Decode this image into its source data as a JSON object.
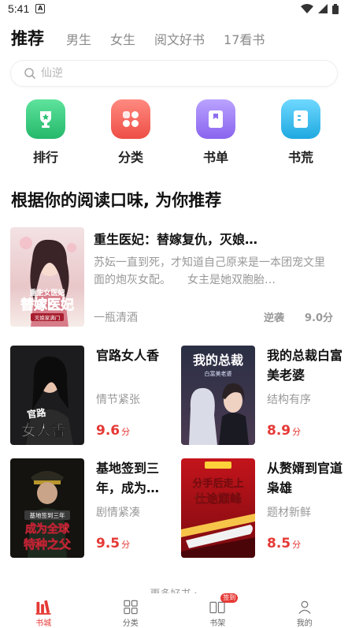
{
  "status_bar": {
    "time": "5:41",
    "notification_glyph": "A"
  },
  "tabs": [
    {
      "label": "推荐",
      "active": true
    },
    {
      "label": "男生",
      "active": false
    },
    {
      "label": "女生",
      "active": false
    },
    {
      "label": "阅文好书",
      "active": false
    },
    {
      "label": "17看书",
      "active": false
    }
  ],
  "search": {
    "placeholder": "仙逆"
  },
  "quick_links": [
    {
      "label": "排行",
      "icon": "trophy-icon",
      "color": "#34c77b"
    },
    {
      "label": "分类",
      "icon": "category-grid-icon",
      "color": "#f0645c"
    },
    {
      "label": "书单",
      "icon": "booklist-icon",
      "color": "#9b7cf2"
    },
    {
      "label": "书荒",
      "icon": "book-open-icon",
      "color": "#2fb7e8"
    }
  ],
  "section_title": "根据你的阅读口味, 为你推荐",
  "featured_book": {
    "title": "重生医妃：替嫁复仇，灭娘…",
    "description": "苏妘一直到死，才知道自己原来是一本团宠文里面的炮灰女配。　　女主是她双胞胎…",
    "author": "一瓶清酒",
    "tag": "逆袭",
    "score": "9.0分",
    "cover_text": "替嫁医妃",
    "cover_subtitle": "灭娘家满门",
    "cover_top": "重生女医妃"
  },
  "books": [
    {
      "title": "官路女人香",
      "tag": "情节紧张",
      "score": "9.6",
      "unit": "分",
      "cover_text_1": "官路",
      "cover_text_2": "女人香"
    },
    {
      "title": "我的总裁白富美老婆",
      "tag": "结构有序",
      "score": "8.9",
      "unit": "分",
      "cover_text_1": "我的总裁",
      "cover_text_2": "白富美老婆"
    },
    {
      "title": "基地签到三年，成为…",
      "tag": "剧情紧凑",
      "score": "9.5",
      "unit": "分",
      "cover_text_1": "基地签到三年",
      "cover_text_2": "成为全球",
      "cover_text_3": "特种之父"
    },
    {
      "title": "从赘婿到官道枭雄",
      "tag": "题材新鲜",
      "score": "8.5",
      "unit": "分",
      "cover_text_1": "分手后走上",
      "cover_text_2": "仕途巅峰"
    }
  ],
  "more_text": "更多好书 ›",
  "bottom_nav": [
    {
      "label": "书城",
      "icon": "bookstore-icon",
      "active": true
    },
    {
      "label": "分类",
      "icon": "category-icon",
      "active": false
    },
    {
      "label": "书架",
      "icon": "bookshelf-icon",
      "active": false,
      "badge": "签到"
    },
    {
      "label": "我的",
      "icon": "profile-icon",
      "active": false
    }
  ],
  "colors": {
    "accent": "#e53935",
    "text_primary": "#111111",
    "text_secondary": "#999999"
  }
}
